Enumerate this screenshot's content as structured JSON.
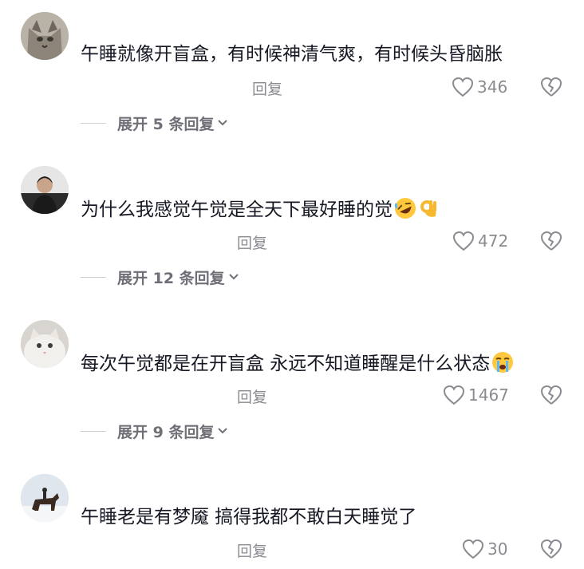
{
  "comments": [
    {
      "text": "午睡就像开盲盒，有时候神清气爽，有时候头昏脑胀",
      "emojis": [],
      "reply_label": "回复",
      "likes": "346",
      "expand_label": "展开 5 条回复"
    },
    {
      "text": "为什么我感觉午觉是全天下最好睡的觉",
      "emojis": [
        "rofl-emoji",
        "ok-hand-emoji"
      ],
      "reply_label": "回复",
      "likes": "472",
      "expand_label": "展开 12 条回复"
    },
    {
      "text": "每次午觉都是在开盲盒 永远不知道睡醒是什么状态",
      "emojis": [
        "crying-emoji"
      ],
      "reply_label": "回复",
      "likes": "1467",
      "expand_label": "展开 9 条回复"
    },
    {
      "text": "午睡老是有梦魇 搞得我都不敢白天睡觉了",
      "emojis": [],
      "reply_label": "回复",
      "likes": "30"
    }
  ],
  "icons": {
    "like": "heart-outline-icon",
    "dislike": "broken-heart-icon",
    "expand": "chevron-down-icon"
  },
  "colors": {
    "text": "#161823",
    "secondary": "#8a8b91",
    "background": "#ffffff"
  }
}
